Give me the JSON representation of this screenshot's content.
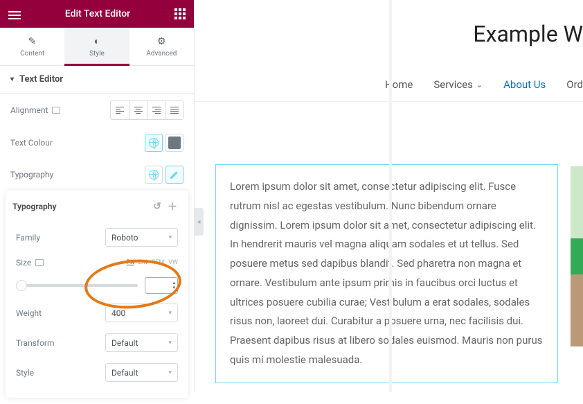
{
  "header": {
    "title": "Edit Text Editor"
  },
  "tabs": {
    "content": "Content",
    "style": "Style",
    "advanced": "Advanced"
  },
  "section": {
    "title": "Text Editor"
  },
  "controls": {
    "alignment": "Alignment",
    "text_colour": "Text Colour",
    "typography": "Typography"
  },
  "typo": {
    "title": "Typography",
    "family_label": "Family",
    "family_value": "Roboto",
    "size_label": "Size",
    "units": {
      "px": "PX",
      "em": "EM",
      "rem": "REM",
      "vw": "VW"
    },
    "weight_label": "Weight",
    "weight_value": "400",
    "transform_label": "Transform",
    "transform_value": "Default",
    "style_label": "Style",
    "style_value": "Default"
  },
  "site": {
    "title": "Example W"
  },
  "nav": {
    "home": "Home",
    "services": "Services",
    "about": "About Us",
    "order": "Ord"
  },
  "body_text": "Lorem ipsum dolor sit amet, consectetur adipiscing elit. Fusce rutrum nisl ac egestas vestibulum. Nunc bibendum ornare dignissim. Lorem ipsum dolor sit amet, consectetur adipiscing elit. In hendrerit mauris vel magna aliquam sodales et ut tellus. Sed posuere metus sed dapibus blandit. Sed pharetra non magna et ornare. Vestibulum ante ipsum primis in faucibus orci luctus et ultrices posuere cubilia curae; Vestibulum a erat sodales, sodales risus non, laoreet dui. Curabitur a posuere urna, nec facilisis dui. Praesent dapibus risus at libero sodales euismod. Mauris non purus quis mi molestie malesuada."
}
